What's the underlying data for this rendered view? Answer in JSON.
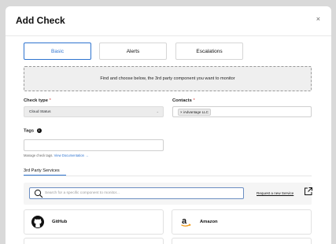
{
  "modal": {
    "title": "Add Check",
    "close_label": "×"
  },
  "tabs": [
    {
      "label": "Basic",
      "active": true
    },
    {
      "label": "Alerts",
      "active": false
    },
    {
      "label": "Escalations",
      "active": false
    }
  ],
  "banner": {
    "text": "Find and choose below, the 3rd party component you want to monitor"
  },
  "fields": {
    "check_type": {
      "label": "Check type",
      "required_mark": "*",
      "value": "Cloud Status"
    },
    "contacts": {
      "label": "Contacts",
      "required_mark": "*",
      "chip": "× iAdvantage LLC"
    },
    "tags": {
      "label": "Tags",
      "info_icon_label": "i",
      "value": "",
      "help_prefix": "Manage check tags.",
      "help_link": "View Documentation →"
    }
  },
  "section": {
    "tab_label": "3rd Party Services"
  },
  "search": {
    "placeholder": "Search for a specific component to monitor...",
    "request_link": "Request a new Service"
  },
  "services": [
    {
      "name": "GitHub",
      "icon": "github-icon"
    },
    {
      "name": "Amazon",
      "icon": "amazon-icon"
    }
  ],
  "colors": {
    "accent": "#2f74d0",
    "required": "#d43b3b"
  }
}
